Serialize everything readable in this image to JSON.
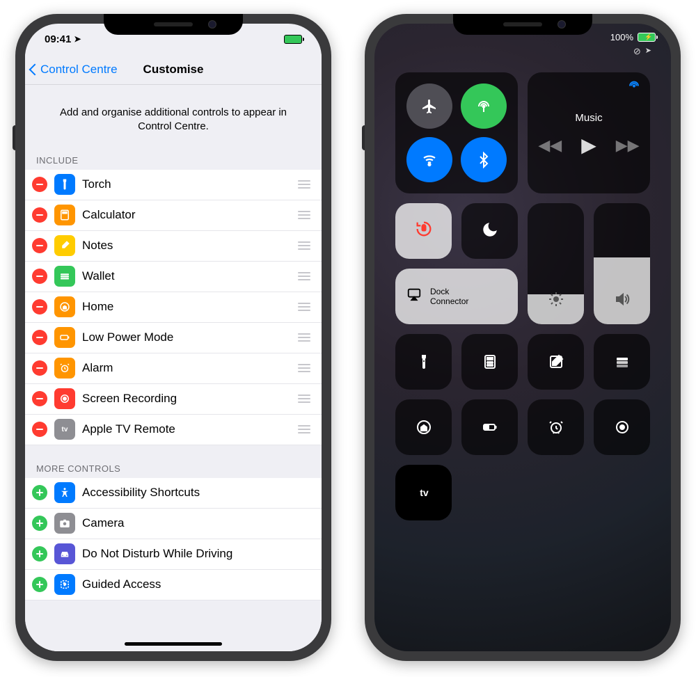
{
  "left": {
    "status": {
      "time": "09:41",
      "location_icon": "➤"
    },
    "nav": {
      "back": "Control Centre",
      "title": "Customise"
    },
    "intro": "Add and organise additional controls to appear in Control Centre.",
    "include_header": "Include",
    "include": [
      {
        "label": "Torch",
        "color": "#007aff",
        "glyph": "torch"
      },
      {
        "label": "Calculator",
        "color": "#ff9500",
        "glyph": "calc"
      },
      {
        "label": "Notes",
        "color": "#ffcc00",
        "glyph": "notes"
      },
      {
        "label": "Wallet",
        "color": "#34c759",
        "glyph": "wallet"
      },
      {
        "label": "Home",
        "color": "#ff9500",
        "glyph": "home"
      },
      {
        "label": "Low Power Mode",
        "color": "#ff9500",
        "glyph": "battery"
      },
      {
        "label": "Alarm",
        "color": "#ff9500",
        "glyph": "alarm"
      },
      {
        "label": "Screen Recording",
        "color": "#ff3b30",
        "glyph": "record"
      },
      {
        "label": "Apple TV Remote",
        "color": "#8e8e93",
        "glyph": "appletv"
      }
    ],
    "more_header": "More Controls",
    "more": [
      {
        "label": "Accessibility Shortcuts",
        "color": "#007aff",
        "glyph": "access"
      },
      {
        "label": "Camera",
        "color": "#8e8e93",
        "glyph": "camera"
      },
      {
        "label": "Do Not Disturb While Driving",
        "color": "#5856d6",
        "glyph": "car"
      },
      {
        "label": "Guided Access",
        "color": "#007aff",
        "glyph": "guided"
      }
    ]
  },
  "right": {
    "battery_pct": "100%",
    "music_label": "Music",
    "mirror_label_1": "Dock",
    "mirror_label_2": "Connector",
    "appletv_label": "tv",
    "brightness_level": 0.25,
    "volume_level": 0.55,
    "toggles": {
      "airplane": false,
      "cellular": true,
      "wifi": true,
      "bluetooth": true,
      "rotation_lock": true,
      "dnd": false
    },
    "tiles": [
      "torch",
      "calculator",
      "notes",
      "wallet",
      "home",
      "low-power",
      "alarm",
      "record",
      "appletv"
    ]
  }
}
